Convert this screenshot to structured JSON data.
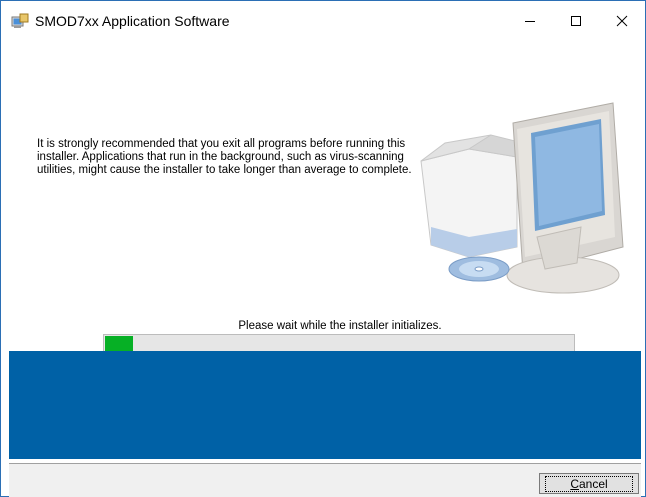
{
  "window": {
    "title": "SMOD7xx Application Software",
    "controls": {
      "minimize": "minimize-icon",
      "maximize": "maximize-icon",
      "close": "close-icon"
    }
  },
  "main": {
    "message": "It is strongly recommended that you exit all programs before running this installer. Applications that run in the background, such as virus-scanning utilities, might cause the installer to take longer than average to complete.",
    "illustration": "computer-with-box-and-disc"
  },
  "progress": {
    "status": "Please wait while the installer initializes.",
    "value_fraction": 0.06,
    "color": "#06b025"
  },
  "colors": {
    "banner": "#0061a6",
    "window_border": "#2b6fb5"
  },
  "footer": {
    "cancel_accel": "C",
    "cancel_rest": "ancel"
  }
}
